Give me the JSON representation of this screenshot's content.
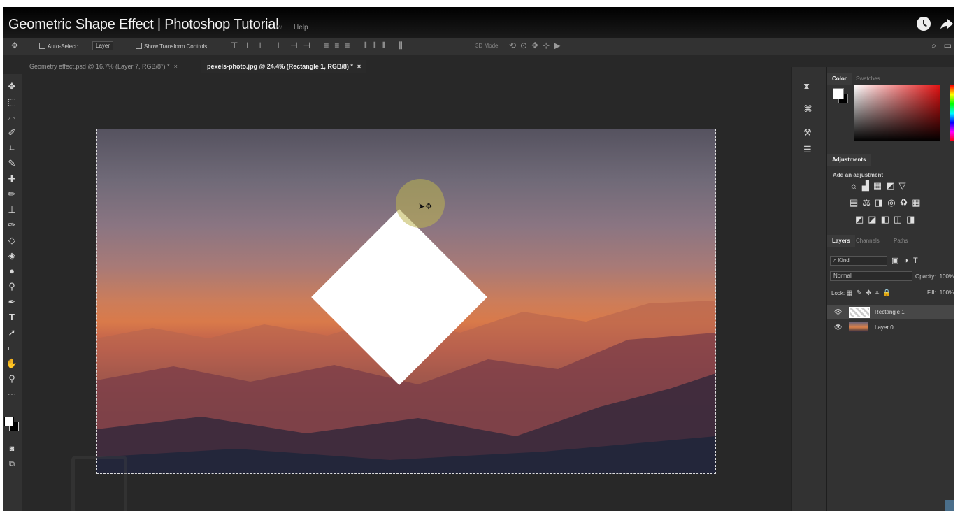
{
  "video": {
    "title": "Geometric Shape Effect | Photoshop Tutorial"
  },
  "menu": {
    "help": "Help",
    "ghost": "w"
  },
  "options_bar": {
    "auto_select": "Auto-Select:",
    "layer_select": "Layer",
    "show_transform": "Show Transform Controls",
    "mode_3d": "3D Mode:"
  },
  "tabs": [
    {
      "label": "Geometry effect.psd @ 16.7% (Layer 7, RGB/8*) *",
      "close": "×"
    },
    {
      "label": "pexels-photo.jpg @ 24.4% (Rectangle 1, RGB/8) *",
      "close": "×"
    }
  ],
  "panels": {
    "color_tabs": [
      "Color",
      "Swatches"
    ],
    "adjustments_tab": "Adjustments",
    "add_adjustment": "Add an adjustment",
    "layers_tabs": [
      "Layers",
      "Channels",
      "Paths"
    ],
    "kind": "Kind",
    "blend_mode": "Normal",
    "opacity_label": "Opacity:",
    "opacity_value": "100%",
    "lock_label": "Lock:",
    "fill_label": "Fill:",
    "fill_value": "100%",
    "layers": [
      {
        "name": "Rectangle 1",
        "selected": true
      },
      {
        "name": "Layer 0",
        "selected": false
      }
    ]
  },
  "colors": {
    "accent_halo": "#beb450",
    "panel_bg": "#323232",
    "canvas_bg": "#282828"
  },
  "icons": [
    "move-icon",
    "marquee-icon",
    "lasso-icon",
    "quick-select-icon",
    "crop-icon",
    "eyedropper-icon",
    "healing-icon",
    "brush-icon",
    "stamp-icon",
    "history-brush-icon",
    "eraser-icon",
    "paint-bucket-icon",
    "blur-icon",
    "dodge-icon",
    "pen-icon",
    "type-icon",
    "path-select-icon",
    "rectangle-icon",
    "hand-icon",
    "zoom-icon",
    "more-icon",
    "clock-icon",
    "share-icon",
    "search-icon"
  ]
}
